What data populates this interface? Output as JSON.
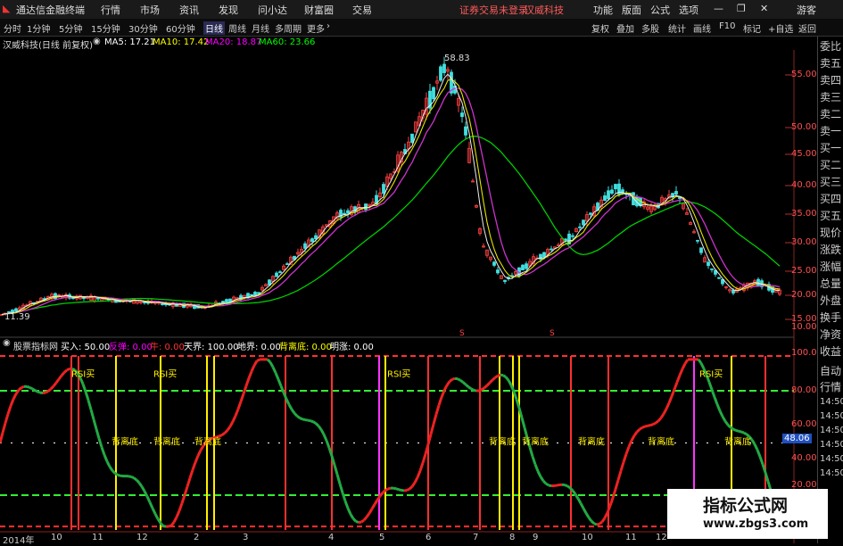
{
  "topbar": {
    "app_title": "通达信金融终端",
    "menu": [
      "行情",
      "市场",
      "资讯",
      "发现",
      "问小达",
      "财富圈",
      "交易"
    ],
    "notice": "证券交易未登录",
    "stock_name": "汉威科技",
    "right_menu": [
      "功能",
      "版面",
      "公式",
      "选项"
    ],
    "guest": "游客"
  },
  "toolbar": {
    "periods": [
      "分时",
      "1分钟",
      "5分钟",
      "15分钟",
      "30分钟",
      "60分钟",
      "日线",
      "周线",
      "月线",
      "多周期",
      "更多"
    ],
    "active_period": "日线",
    "right_buttons": [
      "复权",
      "叠加",
      "多股",
      "统计",
      "画线",
      "F10",
      "标记",
      "+自选",
      "返回"
    ]
  },
  "main_legend": {
    "title": "汉威科技(日线 前复权)",
    "ma": [
      {
        "label": "MA5: 17.21",
        "color": "#ffffff"
      },
      {
        "label": "MA10: 17.42",
        "color": "#ffff00"
      },
      {
        "label": "MA20: 18.87",
        "color": "#ff00ff"
      },
      {
        "label": "MA60: 23.66",
        "color": "#00ff00"
      }
    ]
  },
  "indicator_legend": {
    "title": "股票指标网",
    "items": [
      {
        "label": "买入: 50.00",
        "color": "#ffffff"
      },
      {
        "label": "反弹: 0.00",
        "color": "#ff00ff"
      },
      {
        "label": "牛: 0.00",
        "color": "#ff3333"
      },
      {
        "label": "天界: 100.00",
        "color": "#ffffff"
      },
      {
        "label": "地界: 0.00",
        "color": "#ffffff"
      },
      {
        "label": "背离底: 0.00",
        "color": "#ffff00"
      },
      {
        "label": "明涨: 0.00",
        "color": "#ffffff"
      }
    ]
  },
  "main_axis_labels": [
    "55.00",
    "50.00",
    "45.00",
    "40.00",
    "35.00",
    "30.00",
    "25.00",
    "20.00",
    "15.00",
    "10.00"
  ],
  "indicator_axis_labels": [
    "100.0",
    "80.00",
    "60.00",
    "40.00",
    "20.00"
  ],
  "indicator_current_value": "48.06",
  "price_annotations": {
    "high": "58.83",
    "low": "11.39"
  },
  "indicator_annotations": {
    "rsi": [
      "RSI买",
      "RSI买",
      "RSI买",
      "RSI买"
    ],
    "divergence": [
      "背离底",
      "背离底",
      "背离底",
      "背离底",
      "背离底",
      "背离底",
      "背离底",
      "背离底"
    ]
  },
  "bottom_axis": [
    "2014年",
    "10",
    "11",
    "12",
    "2",
    "3",
    "4",
    "5",
    "6",
    "7",
    "8",
    "9",
    "10",
    "11",
    "12"
  ],
  "right_panel": [
    "委比",
    "卖五",
    "卖四",
    "卖三",
    "卖二",
    "卖一",
    "买一",
    "买二",
    "买三",
    "买四",
    "买五",
    "现价",
    "涨跌",
    "涨幅",
    "总量",
    "外盘",
    "换手",
    "净资",
    "收益",
    "自动",
    "行情"
  ],
  "right_times": [
    "14:50",
    "14:50",
    "14:50",
    "14:50",
    "14:50",
    "14:50"
  ],
  "watermark": {
    "title": "指标公式网",
    "url": "www.zbgs3.com"
  }
}
